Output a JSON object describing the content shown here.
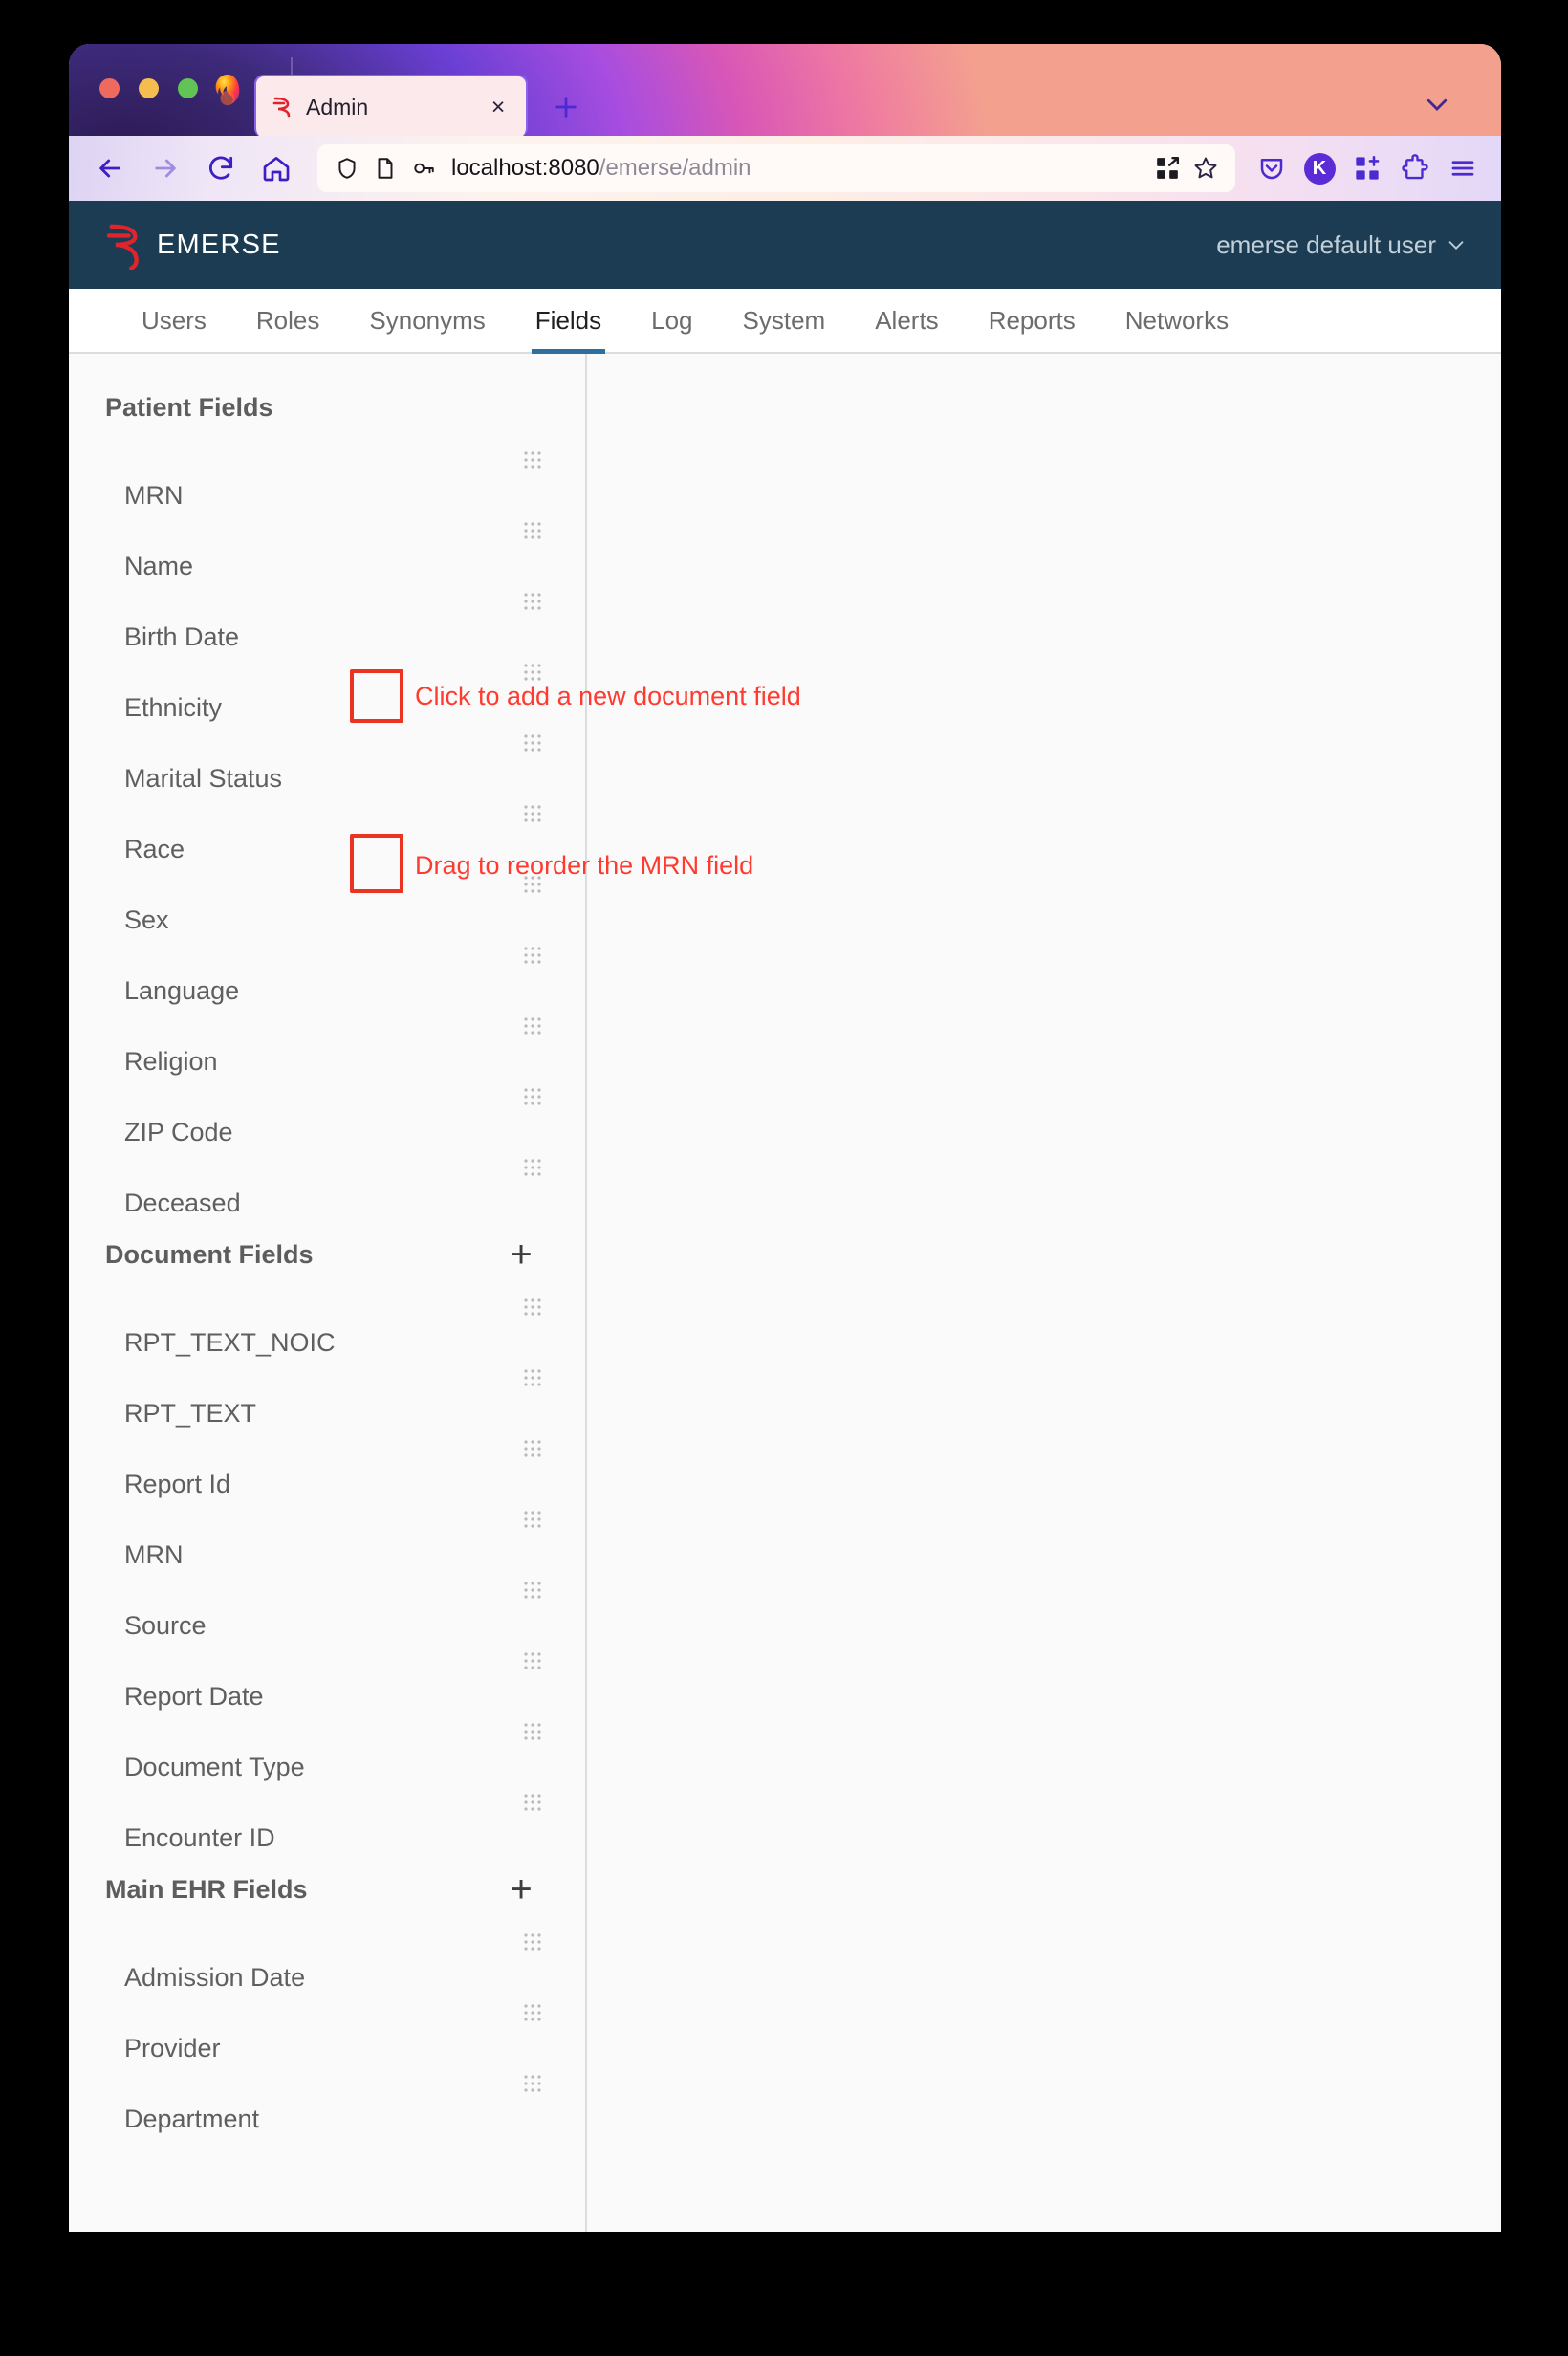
{
  "browser": {
    "tab": {
      "title": "Admin",
      "favicon": "emerse-logo-icon",
      "close_label": "×"
    },
    "new_tab_label": "+",
    "url": {
      "host": "localhost:8080",
      "path": "/emerse/admin",
      "full": "localhost:8080/emerse/admin"
    },
    "nav": {
      "back": "back-arrow",
      "forward": "forward-arrow",
      "reload": "reload",
      "home": "home"
    },
    "toolbar_icons": [
      "shield-icon",
      "page-icon",
      "key-icon",
      "extension-grid-icon",
      "bookmark-star-icon",
      "pocket-icon",
      "account-icon",
      "addons-grid-icon",
      "extensions-puzzle-icon",
      "app-menu-icon"
    ],
    "account_initial": "K"
  },
  "app": {
    "brand": "EMERSE",
    "user": "emerse default user",
    "tabs": [
      {
        "label": "Users",
        "active": false
      },
      {
        "label": "Roles",
        "active": false
      },
      {
        "label": "Synonyms",
        "active": false
      },
      {
        "label": "Fields",
        "active": true
      },
      {
        "label": "Log",
        "active": false
      },
      {
        "label": "System",
        "active": false
      },
      {
        "label": "Alerts",
        "active": false
      },
      {
        "label": "Reports",
        "active": false
      },
      {
        "label": "Networks",
        "active": false
      }
    ]
  },
  "sidebar": {
    "groups": [
      {
        "title": "Patient Fields",
        "has_add": false,
        "add_label": "+",
        "fields": [
          {
            "label": "MRN"
          },
          {
            "label": "Name"
          },
          {
            "label": "Birth Date"
          },
          {
            "label": "Ethnicity"
          },
          {
            "label": "Marital Status"
          },
          {
            "label": "Race"
          },
          {
            "label": "Sex"
          },
          {
            "label": "Language"
          },
          {
            "label": "Religion"
          },
          {
            "label": "ZIP Code"
          },
          {
            "label": "Deceased"
          }
        ]
      },
      {
        "title": "Document Fields",
        "has_add": true,
        "add_label": "+",
        "fields": [
          {
            "label": "RPT_TEXT_NOIC"
          },
          {
            "label": "RPT_TEXT"
          },
          {
            "label": "Report Id"
          },
          {
            "label": "MRN"
          },
          {
            "label": "Source"
          },
          {
            "label": "Report Date"
          },
          {
            "label": "Document Type"
          },
          {
            "label": "Encounter ID"
          }
        ]
      },
      {
        "title": "Main EHR Fields",
        "has_add": true,
        "add_label": "+",
        "fields": [
          {
            "label": "Admission Date"
          },
          {
            "label": "Provider"
          },
          {
            "label": "Department"
          }
        ]
      }
    ]
  },
  "annotations": {
    "highlight_color": "#ea3323",
    "text_color": "#ff3b30",
    "items": [
      {
        "text": "Click to add a new document field"
      },
      {
        "text": "Drag to reorder the MRN field"
      }
    ]
  }
}
